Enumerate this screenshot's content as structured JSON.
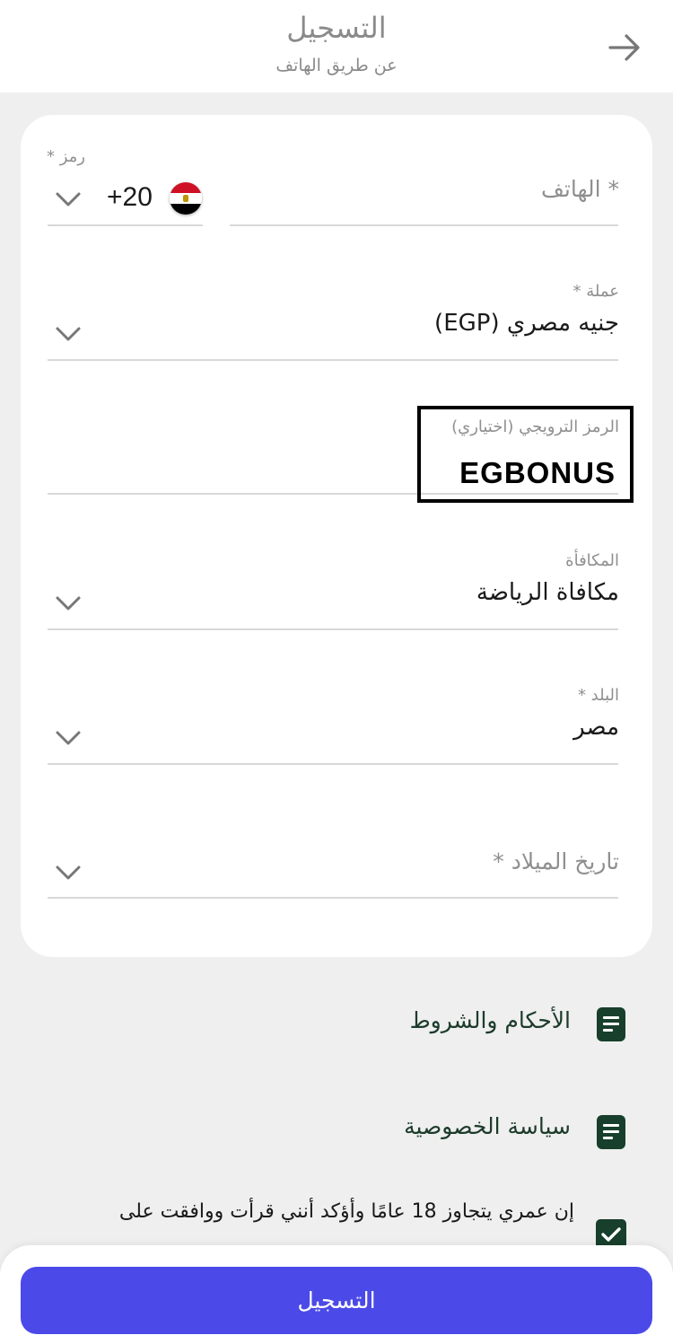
{
  "header": {
    "title": "التسجيل",
    "subtitle": "عن طريق الهاتف",
    "back_icon": "arrow-right-icon"
  },
  "form": {
    "code_label": "* رمز",
    "dial_code": "+20",
    "flag_icon": "egypt-flag-icon",
    "phone_placeholder": "* الهاتف",
    "currency_label": "عملة *",
    "currency_value": "جنيه مصري (EGP)",
    "promo_label": "الرمز الترويجي (اختياري)",
    "promo_value": "EGBONUS",
    "bonus_label": "المكافأة",
    "bonus_value": "مكافاة الرياضة",
    "country_label": "البلد *",
    "country_value": "مصر",
    "birthdate_placeholder": "تاريخ الميلاد *"
  },
  "links": {
    "terms": "الأحكام والشروط",
    "privacy": "سياسة الخصوصية",
    "doc_icon": "document-icon"
  },
  "agreement": {
    "text": "إن عمري يتجاوز 18 عامًا وأؤكد أنني قرأت ووافقت على",
    "checked": true
  },
  "footer": {
    "register_label": "التسجيل"
  },
  "colors": {
    "accent": "#4b4ae8",
    "dark_green": "#173f2b",
    "background": "#efefef"
  }
}
